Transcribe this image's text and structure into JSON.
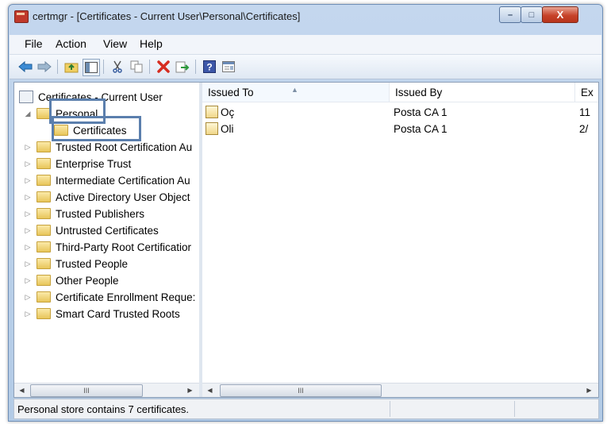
{
  "window": {
    "title": "certmgr - [Certificates - Current User\\Personal\\Certificates]",
    "controls": {
      "minimize": "–",
      "maximize": "□",
      "close": "X"
    }
  },
  "menubar": {
    "items": [
      "File",
      "Action",
      "View",
      "Help"
    ]
  },
  "toolbar": {
    "icons": [
      "back-arrow-icon",
      "forward-arrow-icon",
      "up-folder-icon",
      "show-hide-tree-icon",
      "cut-icon",
      "copy-icon",
      "delete-icon",
      "export-icon",
      "help-icon",
      "properties-icon"
    ]
  },
  "tree": {
    "root": "Certificates - Current User",
    "personal": "Personal",
    "selected_child": "Certificates",
    "items": [
      "Trusted Root Certification Au",
      "Enterprise Trust",
      "Intermediate Certification Au",
      "Active Directory User Object",
      "Trusted Publishers",
      "Untrusted Certificates",
      "Third-Party Root Certificatior",
      "Trusted People",
      "Other People",
      "Certificate Enrollment Reque:",
      "Smart Card Trusted Roots"
    ],
    "scroll_thumb": "III"
  },
  "list": {
    "columns": [
      "Issued To",
      "Issued By",
      "Ex"
    ],
    "rows": [
      {
        "issued_to": "Oç",
        "issued_by": "Posta CA 1",
        "expires": "11"
      },
      {
        "issued_to": "Oli",
        "issued_by": "Posta CA 1",
        "expires": "2/"
      }
    ],
    "scroll_thumb": "III"
  },
  "status": {
    "text": "Personal store contains 7 certificates."
  },
  "colors": {
    "highlight_border": "#5b7fad",
    "title_bar": "#c4d7ee",
    "close_button": "#c7432a"
  }
}
